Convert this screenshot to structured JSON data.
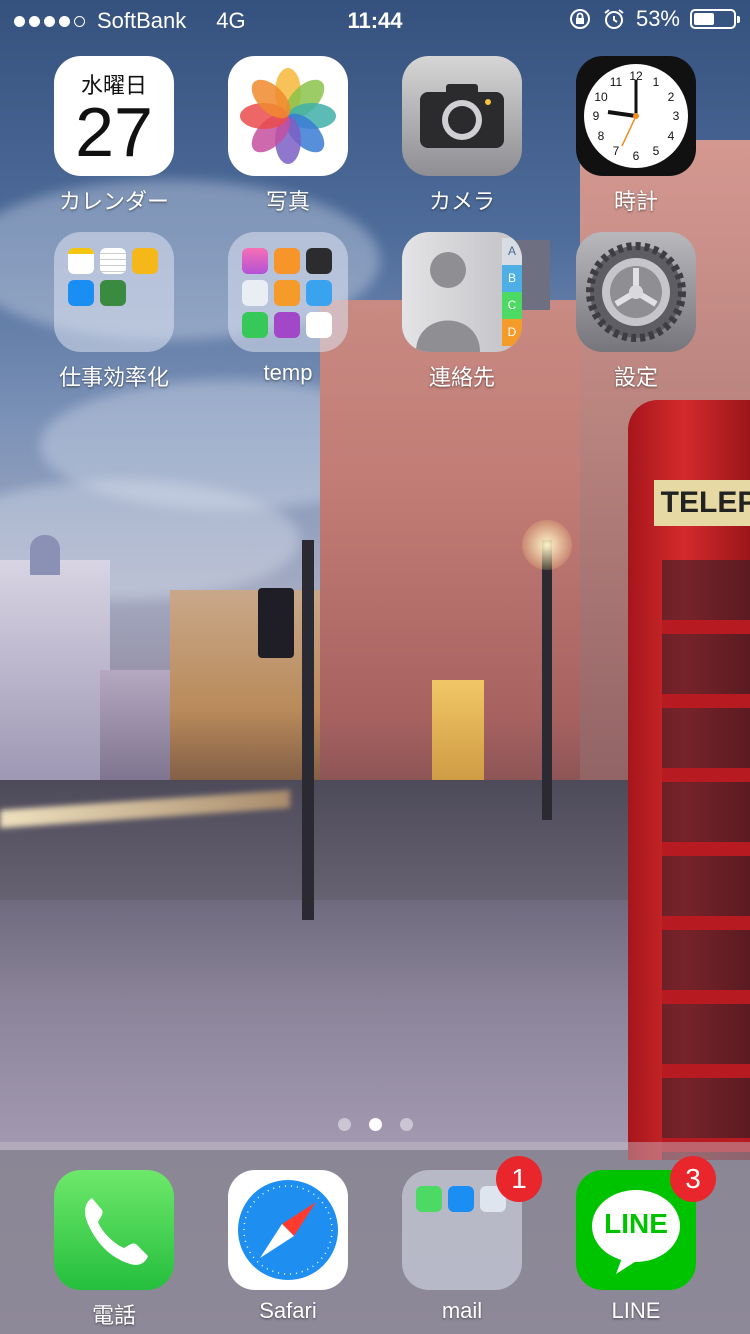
{
  "status_bar": {
    "carrier": "SoftBank",
    "network": "4G",
    "time": "11:44",
    "battery_percent": "53%",
    "battery_level": 0.53,
    "signal_bars": 4,
    "signal_total": 5,
    "icons": [
      "orientation-lock-icon",
      "alarm-icon"
    ]
  },
  "calendar": {
    "weekday": "水曜日",
    "day": "27"
  },
  "home_apps": [
    {
      "label": "カレンダー",
      "icon": "calendar-icon"
    },
    {
      "label": "写真",
      "icon": "photos-icon"
    },
    {
      "label": "カメラ",
      "icon": "camera-icon"
    },
    {
      "label": "時計",
      "icon": "clock-icon"
    },
    {
      "label": "仕事効率化",
      "icon": "folder-icon"
    },
    {
      "label": "temp",
      "icon": "folder-icon"
    },
    {
      "label": "連絡先",
      "icon": "contacts-icon"
    },
    {
      "label": "設定",
      "icon": "settings-icon"
    }
  ],
  "contacts_tabs": [
    "A",
    "B",
    "C",
    "D"
  ],
  "clock_numbers": [
    "12",
    "1",
    "2",
    "3",
    "4",
    "5",
    "6",
    "7",
    "8",
    "9",
    "10",
    "11"
  ],
  "phone_booth_sign": "TELEP",
  "page_indicator": {
    "count": 3,
    "active": 2
  },
  "dock": [
    {
      "label": "電話",
      "icon": "phone-icon",
      "badge": ""
    },
    {
      "label": "Safari",
      "icon": "safari-icon",
      "badge": ""
    },
    {
      "label": "mail",
      "icon": "folder-icon",
      "badge": "1"
    },
    {
      "label": "LINE",
      "icon": "line-icon",
      "badge": "3",
      "icon_text": "LINE"
    }
  ],
  "colors": {
    "badge": "#e8262b",
    "phone_green": "#4cd964",
    "line_green": "#00c300",
    "safari_blue": "#1e8ff0"
  }
}
